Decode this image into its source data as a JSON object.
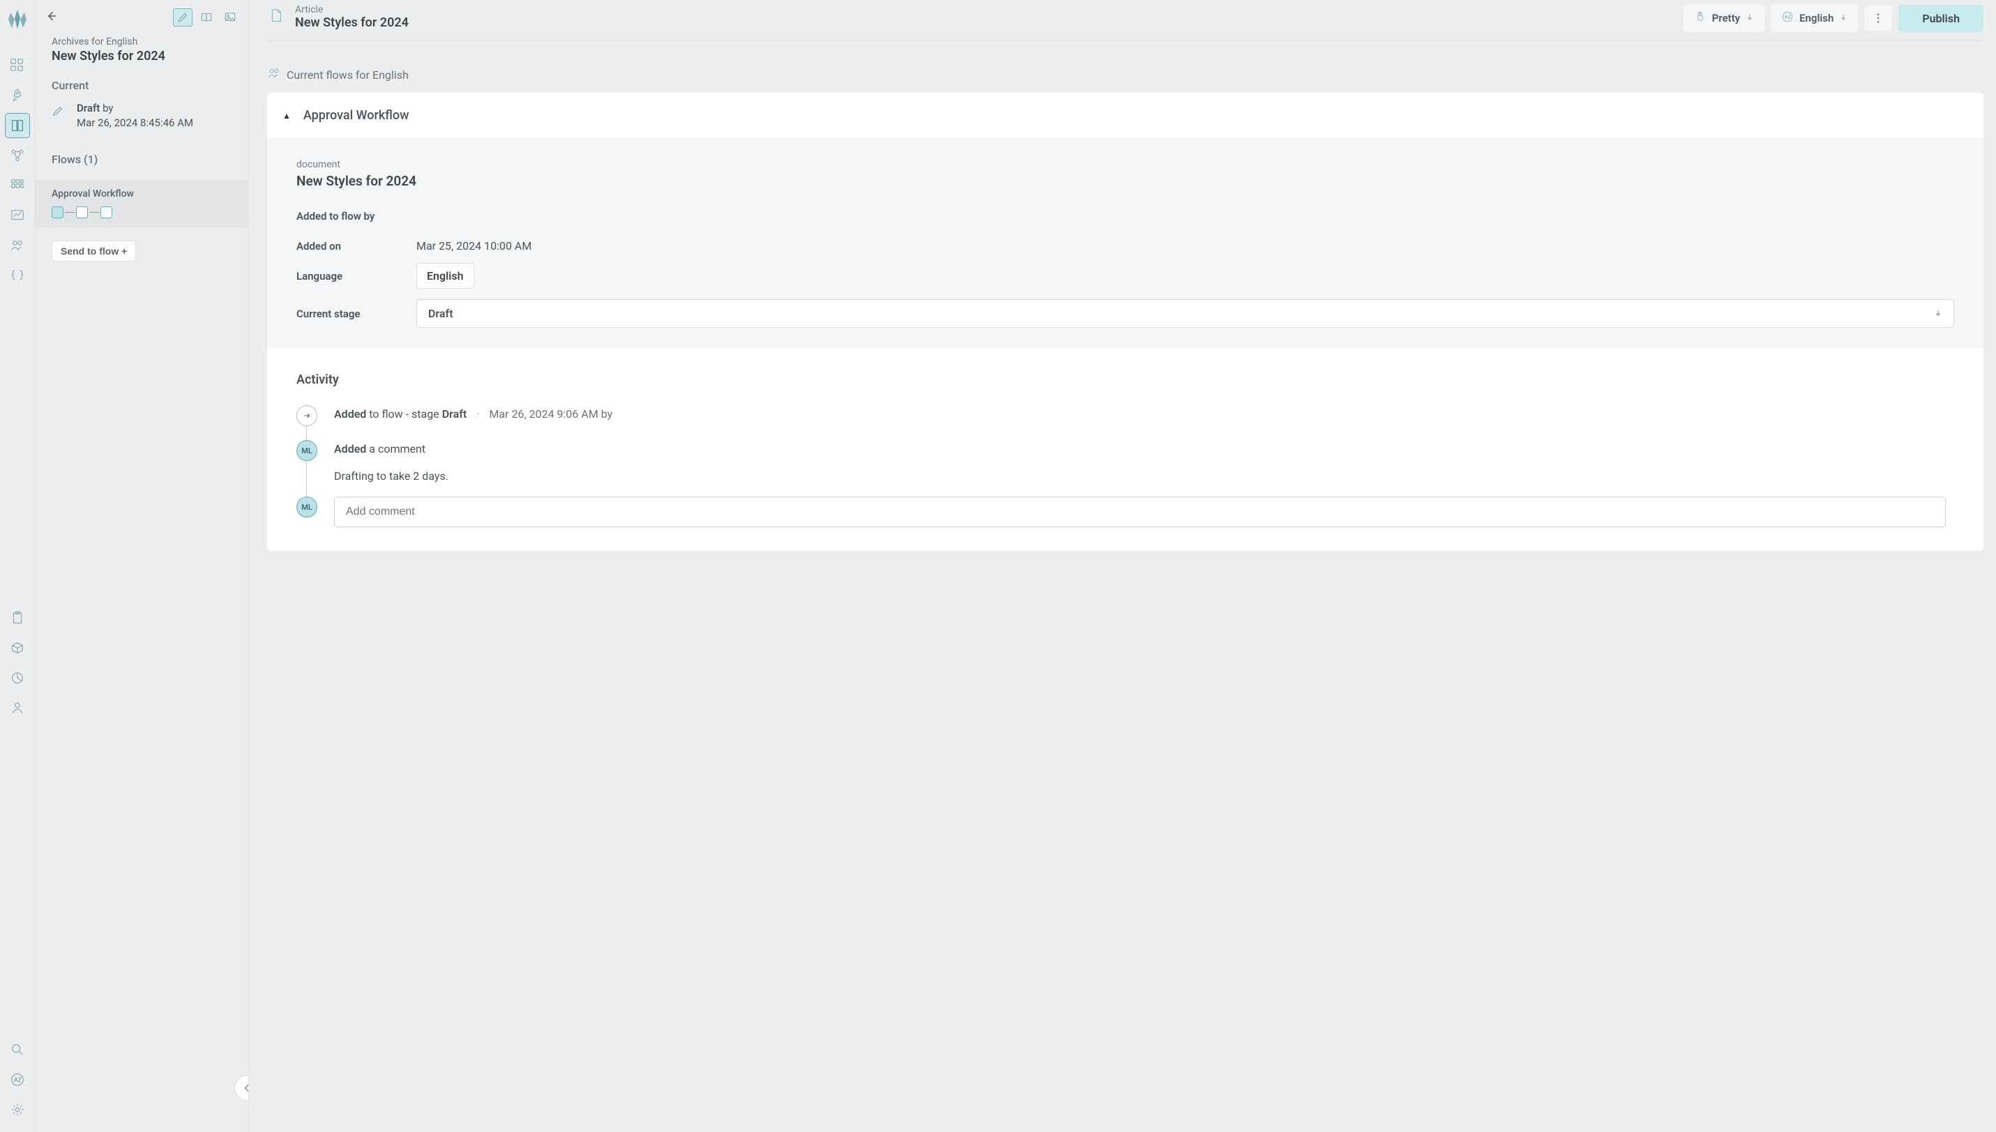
{
  "rail": {
    "nav_items": [
      {
        "name": "dashboard",
        "icon": "grid"
      },
      {
        "name": "quickstart",
        "icon": "rocket"
      },
      {
        "name": "content",
        "icon": "book",
        "active": true
      },
      {
        "name": "structure",
        "icon": "nodes"
      },
      {
        "name": "apps",
        "icon": "appgrid"
      },
      {
        "name": "analytics",
        "icon": "linechart"
      },
      {
        "name": "users",
        "icon": "people"
      },
      {
        "name": "api",
        "icon": "braces"
      }
    ],
    "mid_items": [
      {
        "name": "clipboard",
        "icon": "clipboard"
      },
      {
        "name": "package",
        "icon": "package"
      },
      {
        "name": "reports",
        "icon": "piechart"
      },
      {
        "name": "members",
        "icon": "person"
      }
    ],
    "bottom_items": [
      {
        "name": "search",
        "icon": "magnify"
      },
      {
        "name": "locales",
        "icon": "az"
      },
      {
        "name": "settings",
        "icon": "gear"
      }
    ]
  },
  "sidebar": {
    "modes": [
      {
        "name": "edit",
        "icon": "pencil",
        "active": true
      },
      {
        "name": "read",
        "icon": "openbook"
      },
      {
        "name": "media",
        "icon": "image"
      }
    ],
    "path_label": "Archives for English",
    "title": "New Styles for 2024",
    "current_label": "Current",
    "draft": {
      "prefix": "Draft",
      "by": "by",
      "timestamp": "Mar 26, 2024 8:45:46 AM"
    },
    "flows_label": "Flows (1)",
    "flow_item": {
      "title": "Approval Workflow",
      "steps": 3
    },
    "send_to_flow_label": "Send to flow +"
  },
  "header": {
    "type_label": "Article",
    "title": "New Styles for 2024",
    "pretty_label": "Pretty",
    "lang_label": "English",
    "publish_label": "Publish"
  },
  "current_flows_label": "Current flows for English",
  "workflow": {
    "name": "Approval Workflow",
    "doc_label": "document",
    "doc_title": "New Styles for 2024",
    "added_by_label": "Added to flow by",
    "added_on_label": "Added on",
    "added_on_value": "Mar 25, 2024 10:00 AM",
    "language_label": "Language",
    "language_value": "English",
    "stage_label": "Current stage",
    "stage_value": "Draft"
  },
  "activity": {
    "title": "Activity",
    "avatar_initials": "ML",
    "items": [
      {
        "kind": "added",
        "prefix": "Added",
        "middle": "to flow - stage",
        "stage": "Draft",
        "stamp": "Mar 26, 2024 9:06 AM by"
      },
      {
        "kind": "comment",
        "prefix": "Added",
        "suffix": "a comment",
        "body": "Drafting to take 2 days."
      }
    ],
    "comment_placeholder": "Add comment"
  }
}
